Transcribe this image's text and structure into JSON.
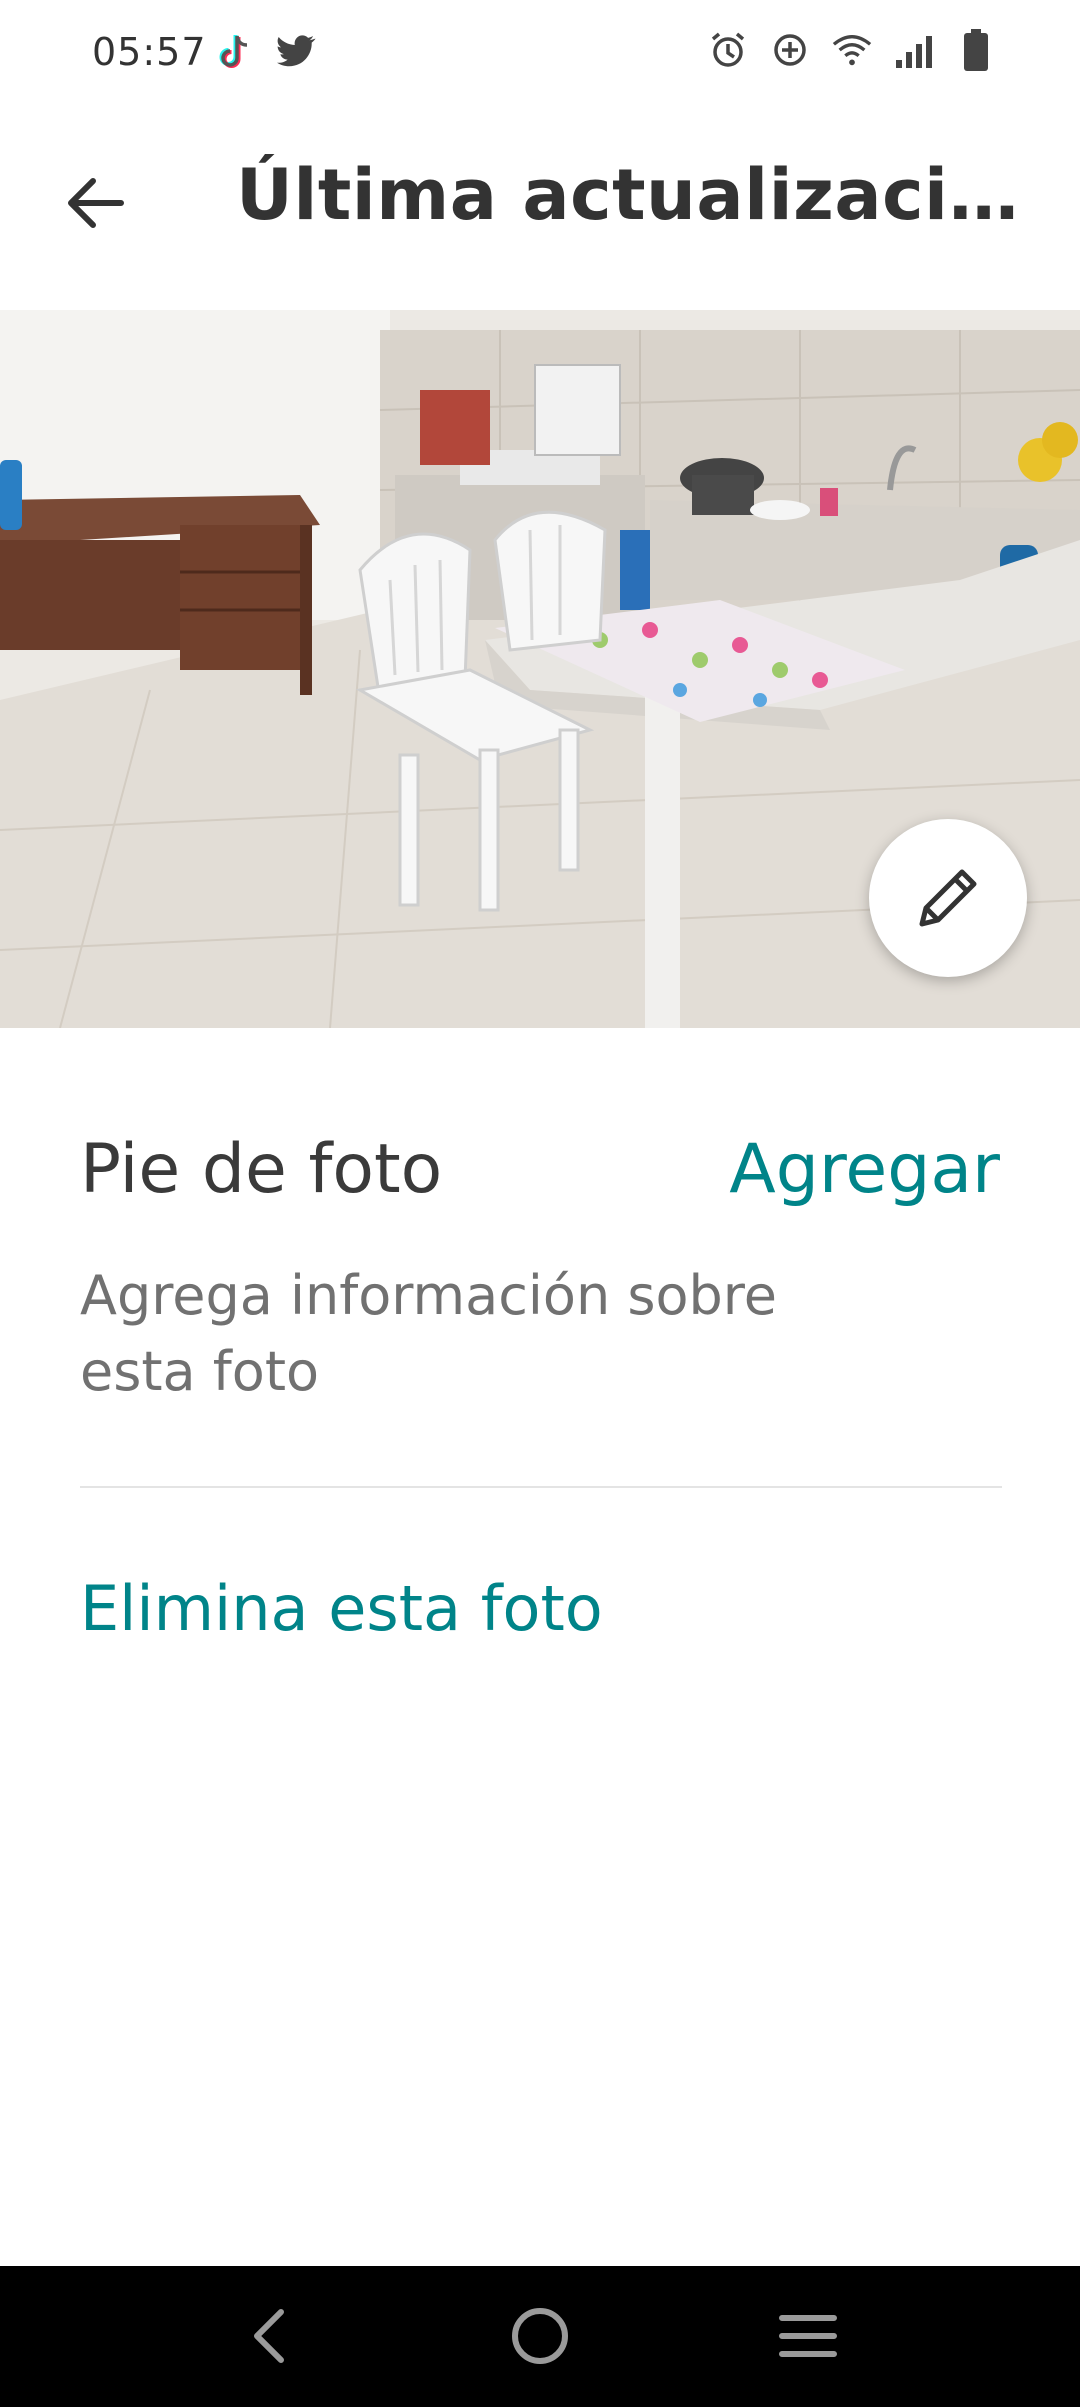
{
  "status_bar": {
    "time": "05:57",
    "left_icons": [
      "tiktok-icon",
      "twitter-icon"
    ],
    "right_icons": [
      "alarm-icon",
      "data-saver-icon",
      "wifi-icon",
      "signal-icon",
      "battery-icon"
    ]
  },
  "header": {
    "title": "Última actualización..."
  },
  "photo": {
    "description_icon": "photo-image",
    "edit_icon": "pencil-icon"
  },
  "caption": {
    "label": "Pie de foto",
    "action": "Agregar",
    "hint": "Agrega información sobre esta foto"
  },
  "delete": {
    "label": "Elimina esta foto"
  },
  "nav_bar": {
    "icons": [
      "nav-back-icon",
      "nav-home-icon",
      "nav-recents-icon"
    ]
  },
  "colors": {
    "accent": "#008489",
    "text_primary": "#333333",
    "text_secondary": "#717171",
    "nav_background": "#000000"
  }
}
